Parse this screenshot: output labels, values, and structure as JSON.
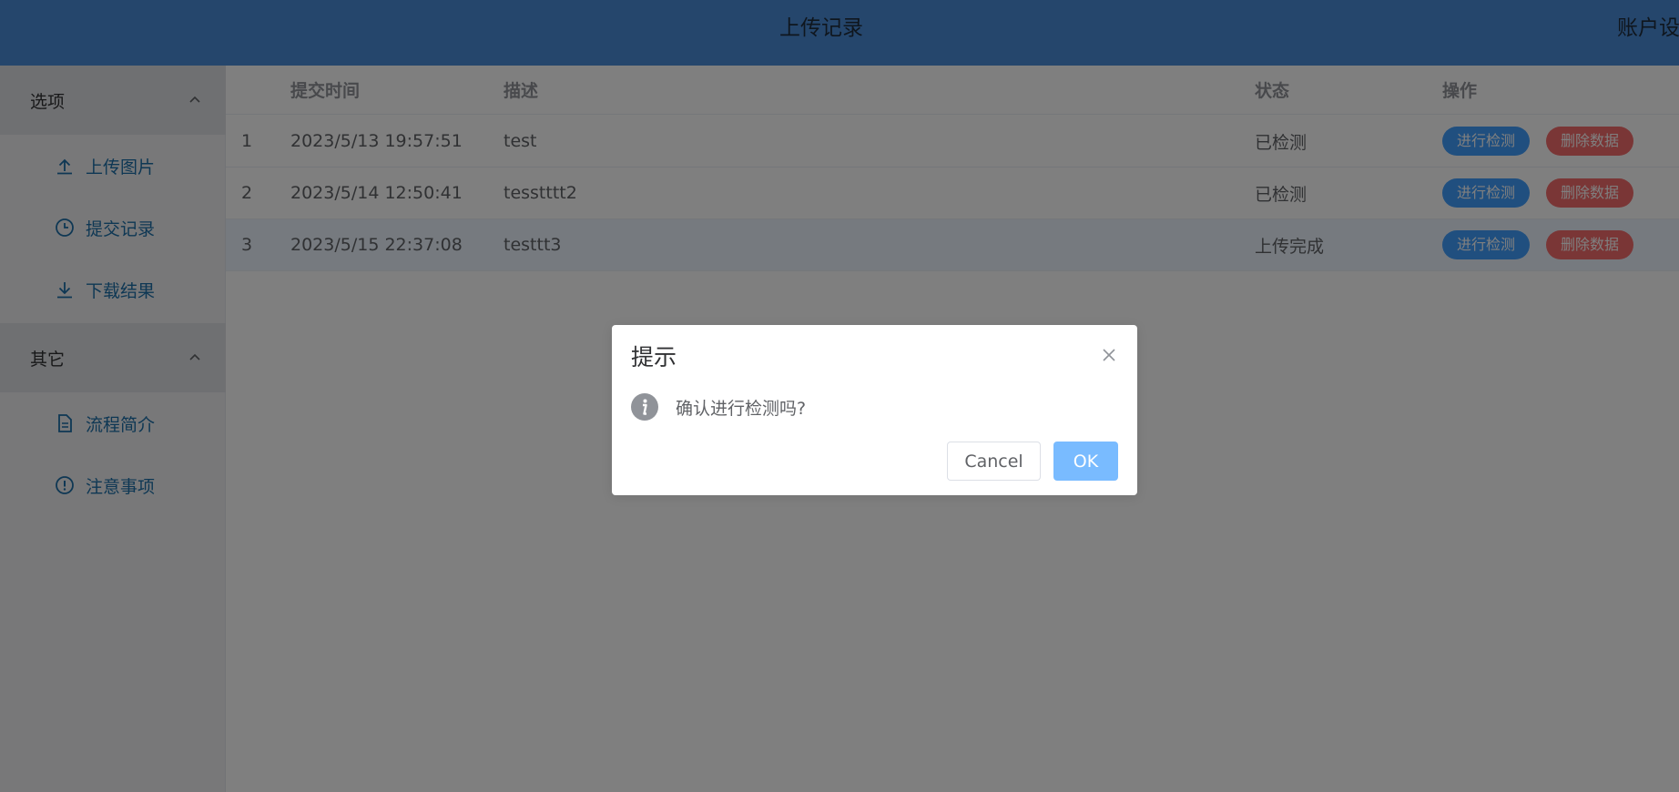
{
  "header": {
    "title": "上传记录",
    "account": "账户设"
  },
  "sidebar": {
    "groups": [
      {
        "label": "选项",
        "chevron_icon": "chevron-up-icon",
        "items": [
          {
            "label": "上传图片",
            "icon": "upload-icon"
          },
          {
            "label": "提交记录",
            "icon": "clock-icon"
          },
          {
            "label": "下载结果",
            "icon": "download-icon"
          }
        ]
      },
      {
        "label": "其它",
        "chevron_icon": "chevron-up-icon",
        "items": [
          {
            "label": "流程简介",
            "icon": "document-icon"
          },
          {
            "label": "注意事项",
            "icon": "warning-icon"
          }
        ]
      }
    ]
  },
  "table": {
    "columns": [
      "",
      "提交时间",
      "描述",
      "状态",
      "操作"
    ],
    "rows": [
      {
        "index": "1",
        "time": "2023/5/13 19:57:51",
        "desc": "test",
        "status": "已检测",
        "action_detect": "进行检测",
        "action_delete": "删除数据"
      },
      {
        "index": "2",
        "time": "2023/5/14 12:50:41",
        "desc": "tesstttt2",
        "status": "已检测",
        "action_detect": "进行检测",
        "action_delete": "删除数据"
      },
      {
        "index": "3",
        "time": "2023/5/15 22:37:08",
        "desc": "testtt3",
        "status": "上传完成",
        "action_detect": "进行检测",
        "action_delete": "删除数据"
      }
    ]
  },
  "dialog": {
    "title": "提示",
    "message": "确认进行检测吗?",
    "cancel_label": "Cancel",
    "ok_label": "OK"
  },
  "colors": {
    "header_bg": "#4b8cd9",
    "primary": "#409eff",
    "danger": "#f56c6c",
    "ok_button": "#79bbff",
    "menu_text": "#1c6fa8"
  }
}
